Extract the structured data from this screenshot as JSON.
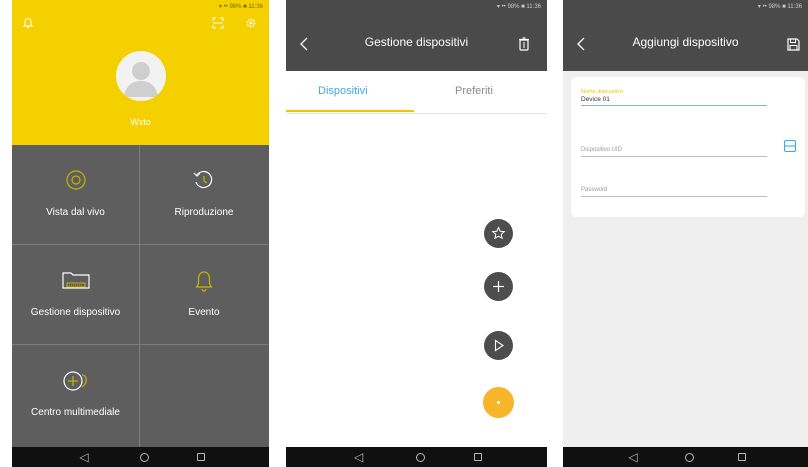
{
  "screen1": {
    "status_text": "▾ •• 98% ■ 11:36",
    "username": "Wxto",
    "tiles": [
      {
        "label": "Vista dal vivo",
        "icon": "play-circle-icon"
      },
      {
        "label": "Riproduzione",
        "icon": "replay-clock-icon"
      },
      {
        "label": "Gestione dispositivo",
        "icon": "dvr-folder-icon"
      },
      {
        "label": "Evento",
        "icon": "bell-icon"
      },
      {
        "label": "Centro multimediale",
        "icon": "media-center-icon"
      },
      {
        "label": "",
        "icon": ""
      }
    ]
  },
  "screen2": {
    "status_text": "▾ •• 98% ■ 11:36",
    "title": "Gestione dispositivi",
    "tabs": [
      {
        "label": "Dispositivi",
        "active": true
      },
      {
        "label": "Preferiti",
        "active": false
      }
    ],
    "fabs": [
      "star-add-icon",
      "plus-icon",
      "play-icon",
      "dot-icon"
    ]
  },
  "screen3": {
    "status_text": "▾ •• 98% ■ 11:36",
    "title": "Aggiungi dispositivo",
    "fields": {
      "name_label": "Nome dispositivo",
      "name_value": "Device 01",
      "uid_placeholder": "Dispositivo UID",
      "password_placeholder": "Password"
    }
  },
  "colors": {
    "accent_yellow": "#f5d000",
    "tab_blue": "#3fa9e8",
    "fab_orange": "#f6b52a",
    "dark_bar": "#4a4a4a",
    "tile_gray": "#5e5e5e"
  }
}
